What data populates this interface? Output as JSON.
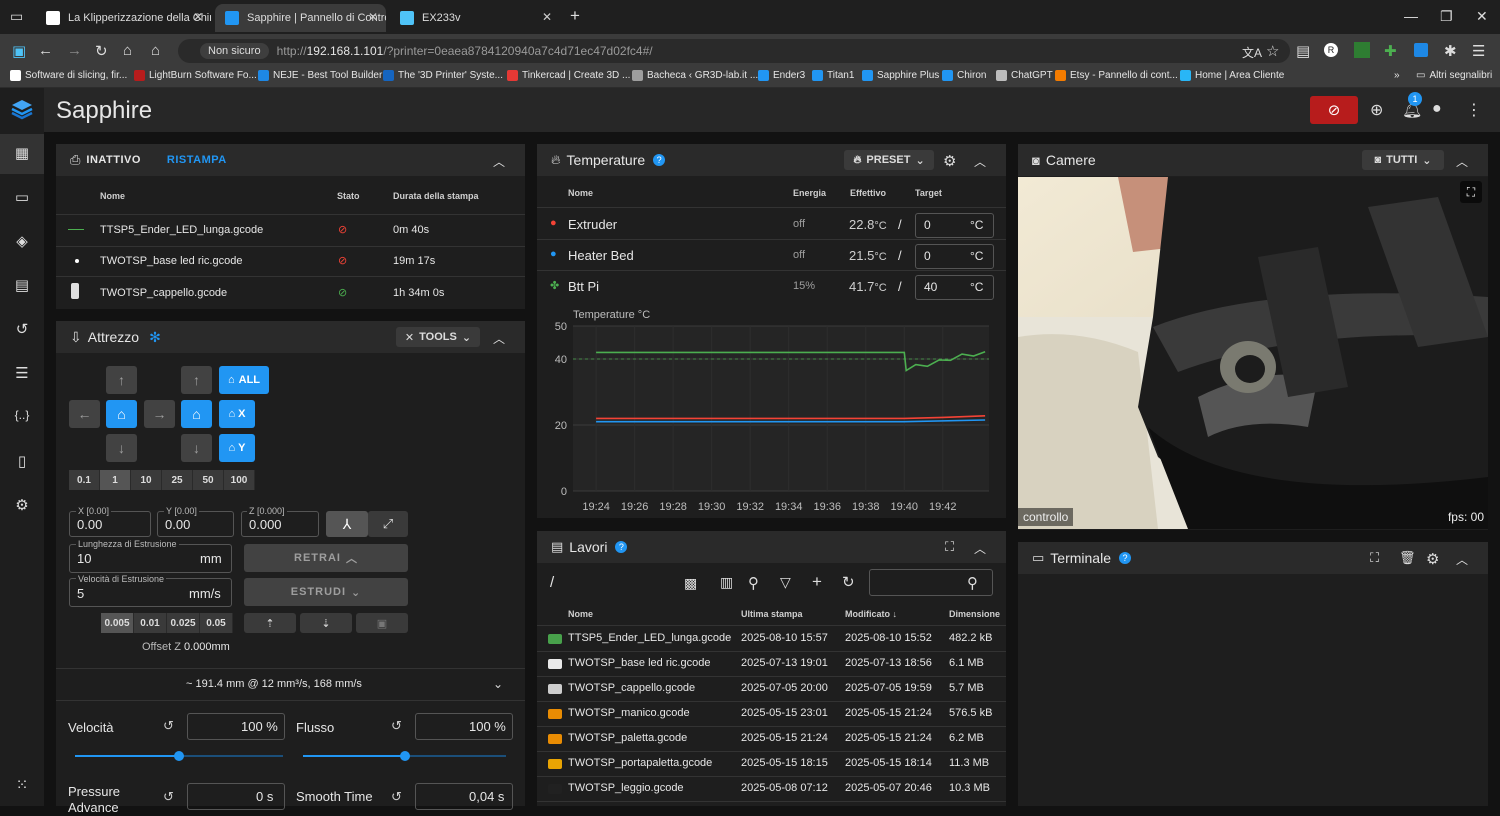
{
  "browser": {
    "tabs": [
      {
        "title": "La Klipperizzazione della Chiron",
        "active": false,
        "favicon_color": "#ffffff"
      },
      {
        "title": "Sapphire | Pannello di Controllo",
        "active": true,
        "favicon_color": "#2196f3"
      },
      {
        "title": "EX233v",
        "active": false,
        "favicon_color": "#4fc3f7"
      }
    ],
    "new_tab": "+",
    "not_secure_label": "Non sicuro",
    "url_prefix": "http://",
    "url_host": "192.168.1.101",
    "url_rest": "/?printer=0eaea8784120940a7c4d71ec47d02fc4#/",
    "bookmarks": [
      {
        "label": "Software di slicing, fir...",
        "color": "#ffffff"
      },
      {
        "label": "LightBurn Software Fo...",
        "color": "#b71c1c"
      },
      {
        "label": "NEJE - Best Tool Builder",
        "color": "#1e88e5"
      },
      {
        "label": "The '3D Printer' Syste...",
        "color": "#1565c0"
      },
      {
        "label": "Tinkercad | Create 3D ...",
        "color": "#e53935"
      },
      {
        "label": "Bacheca ‹ GR3D-lab.it ...",
        "color": "#9e9e9e"
      },
      {
        "label": "Ender3",
        "color": "#2196f3"
      },
      {
        "label": "Titan1",
        "color": "#2196f3"
      },
      {
        "label": "Sapphire Plus",
        "color": "#2196f3"
      },
      {
        "label": "Chiron",
        "color": "#2196f3"
      },
      {
        "label": "ChatGPT",
        "color": "#bdbdbd"
      },
      {
        "label": "Etsy - Pannello di cont...",
        "color": "#f57c00"
      },
      {
        "label": "Home | Area Cliente",
        "color": "#29b6f6"
      }
    ],
    "other_bookmarks": "Altri segnalibri"
  },
  "app": {
    "title": "Sapphire",
    "notification_count": "1"
  },
  "status": {
    "state": "INATTIVO",
    "reprint": "RISTAMPA",
    "headers": {
      "name": "Nome",
      "state": "Stato",
      "duration": "Durata della stampa"
    },
    "rows": [
      {
        "name": "TTSP5_Ender_LED_lunga.gcode",
        "duration": "0m 40s",
        "ok": false
      },
      {
        "name": "TWOTSP_base led ric.gcode",
        "duration": "19m 17s",
        "ok": false
      },
      {
        "name": "TWOTSP_cappello.gcode",
        "duration": "1h 34m 0s",
        "ok": true
      }
    ]
  },
  "tool": {
    "title": "Attrezzo",
    "tools_btn": "TOOLS",
    "home_all": "ALL",
    "home_x": "X",
    "home_y": "Y",
    "steps": [
      "0.1",
      "1",
      "10",
      "25",
      "50",
      "100"
    ],
    "selected_step": "1",
    "x_label": "X [0.00]",
    "x_value": "0.00",
    "y_label": "Y [0.00]",
    "y_value": "0.00",
    "z_label": "Z [0.000]",
    "z_value": "0.000",
    "extrude_length_label": "Lunghezza di Estrusione",
    "extrude_length": "10",
    "extrude_length_unit": "mm",
    "extrude_speed_label": "Velocità di Estrusione",
    "extrude_speed": "5",
    "extrude_speed_unit": "mm/s",
    "retract": "RETRAI",
    "extrude": "ESTRUDI",
    "zoffset_steps": [
      "0.005",
      "0.01",
      "0.025",
      "0.05"
    ],
    "zoffset_label": "Offset Z",
    "zoffset_value": "0.000mm",
    "flow_summary": "~ 191.4 mm @ 12 mm³/s, 168 mm/s",
    "speed_label": "Velocità",
    "speed_value": "100 %",
    "speed_pct": 0.5,
    "flow_label": "Flusso",
    "flow_value": "100 %",
    "flow_pct": 0.5,
    "pa_label": "Pressure Advance",
    "pa_value": "0 s",
    "smooth_label": "Smooth Time",
    "smooth_value": "0,04 s"
  },
  "temps": {
    "title": "Temperature",
    "preset": "PRESET",
    "headers": {
      "name": "Nome",
      "power": "Energia",
      "actual": "Effettivo",
      "target": "Target"
    },
    "rows": [
      {
        "name": "Extruder",
        "power": "off",
        "actual": "22.8",
        "unit": "°C",
        "target": "0",
        "color": "#f44336"
      },
      {
        "name": "Heater Bed",
        "power": "off",
        "actual": "21.5",
        "unit": "°C",
        "target": "0",
        "color": "#2196f3"
      },
      {
        "name": "Btt Pi",
        "power": "15%",
        "actual": "41.7",
        "unit": "°C",
        "target": "40",
        "color": "#4caf50"
      }
    ],
    "target_unit": "°C"
  },
  "chart_data": {
    "type": "line",
    "ylabel": "Temperature °C",
    "ylim": [
      0,
      50
    ],
    "yticks": [
      0,
      20,
      40,
      50
    ],
    "x": [
      "19:24",
      "19:26",
      "19:28",
      "19:30",
      "19:32",
      "19:34",
      "19:36",
      "19:38",
      "19:40",
      "19:42"
    ],
    "grid": true,
    "series": [
      {
        "name": "Btt Pi",
        "color": "#4caf50",
        "target": 40,
        "points": [
          [
            0,
            42
          ],
          [
            0.5,
            42
          ],
          [
            1,
            42
          ],
          [
            1.5,
            42
          ],
          [
            2,
            42
          ],
          [
            2.5,
            42
          ],
          [
            3,
            42
          ],
          [
            3.5,
            42
          ],
          [
            4,
            42
          ],
          [
            4.5,
            42
          ],
          [
            5,
            42
          ],
          [
            5.5,
            42
          ],
          [
            6,
            42
          ],
          [
            6.5,
            42
          ],
          [
            7,
            42
          ],
          [
            7.5,
            42
          ],
          [
            8,
            42
          ],
          [
            8.05,
            37
          ],
          [
            8.3,
            37.8
          ],
          [
            8.6,
            38.3
          ],
          [
            8.9,
            39.2
          ],
          [
            9.2,
            40.1
          ],
          [
            9.5,
            41
          ],
          [
            9.8,
            41.4
          ],
          [
            10.1,
            41.7
          ]
        ]
      },
      {
        "name": "Extruder",
        "color": "#f44336",
        "points": [
          [
            0,
            22
          ],
          [
            4,
            22
          ],
          [
            8,
            22
          ],
          [
            9,
            22.3
          ],
          [
            10.1,
            22.8
          ]
        ]
      },
      {
        "name": "Heater Bed",
        "color": "#2196f3",
        "points": [
          [
            0,
            21
          ],
          [
            4,
            21
          ],
          [
            8,
            21
          ],
          [
            10.1,
            21.5
          ]
        ]
      }
    ]
  },
  "camera": {
    "title": "Camere",
    "all_btn": "TUTTI",
    "name": "controllo",
    "fps": "fps: 00"
  },
  "jobs": {
    "title": "Lavori",
    "path": "/",
    "headers": {
      "name": "Nome",
      "last_print": "Ultima stampa",
      "modified": "Modificato",
      "size": "Dimensione"
    },
    "rows": [
      {
        "name": "TTSP5_Ender_LED_lunga.gcode",
        "last": "2025-08-10 15:57",
        "mod": "2025-08-10 15:52",
        "size": "482.2 kB",
        "thumb": "#4caf50"
      },
      {
        "name": "TWOTSP_base led ric.gcode",
        "last": "2025-07-13 19:01",
        "mod": "2025-07-13 18:56",
        "size": "6.1 MB",
        "thumb": "#ffffff"
      },
      {
        "name": "TWOTSP_cappello.gcode",
        "last": "2025-07-05 20:00",
        "mod": "2025-07-05 19:59",
        "size": "5.7 MB",
        "thumb": "#e0e0e0"
      },
      {
        "name": "TWOTSP_manico.gcode",
        "last": "2025-05-15 23:01",
        "mod": "2025-05-15 21:24",
        "size": "576.5 kB",
        "thumb": "#ff9800"
      },
      {
        "name": "TWOTSP_paletta.gcode",
        "last": "2025-05-15 21:24",
        "mod": "2025-05-15 21:24",
        "size": "6.2 MB",
        "thumb": "#ff9800"
      },
      {
        "name": "TWOTSP_portapaletta.gcode",
        "last": "2025-05-15 18:15",
        "mod": "2025-05-15 18:14",
        "size": "11.3 MB",
        "thumb": "#ffb300"
      },
      {
        "name": "TWOTSP_leggio.gcode",
        "last": "2025-05-08 07:12",
        "mod": "2025-05-07 20:46",
        "size": "10.3 MB",
        "thumb": "#212121"
      }
    ]
  },
  "terminal": {
    "title": "Terminale"
  }
}
